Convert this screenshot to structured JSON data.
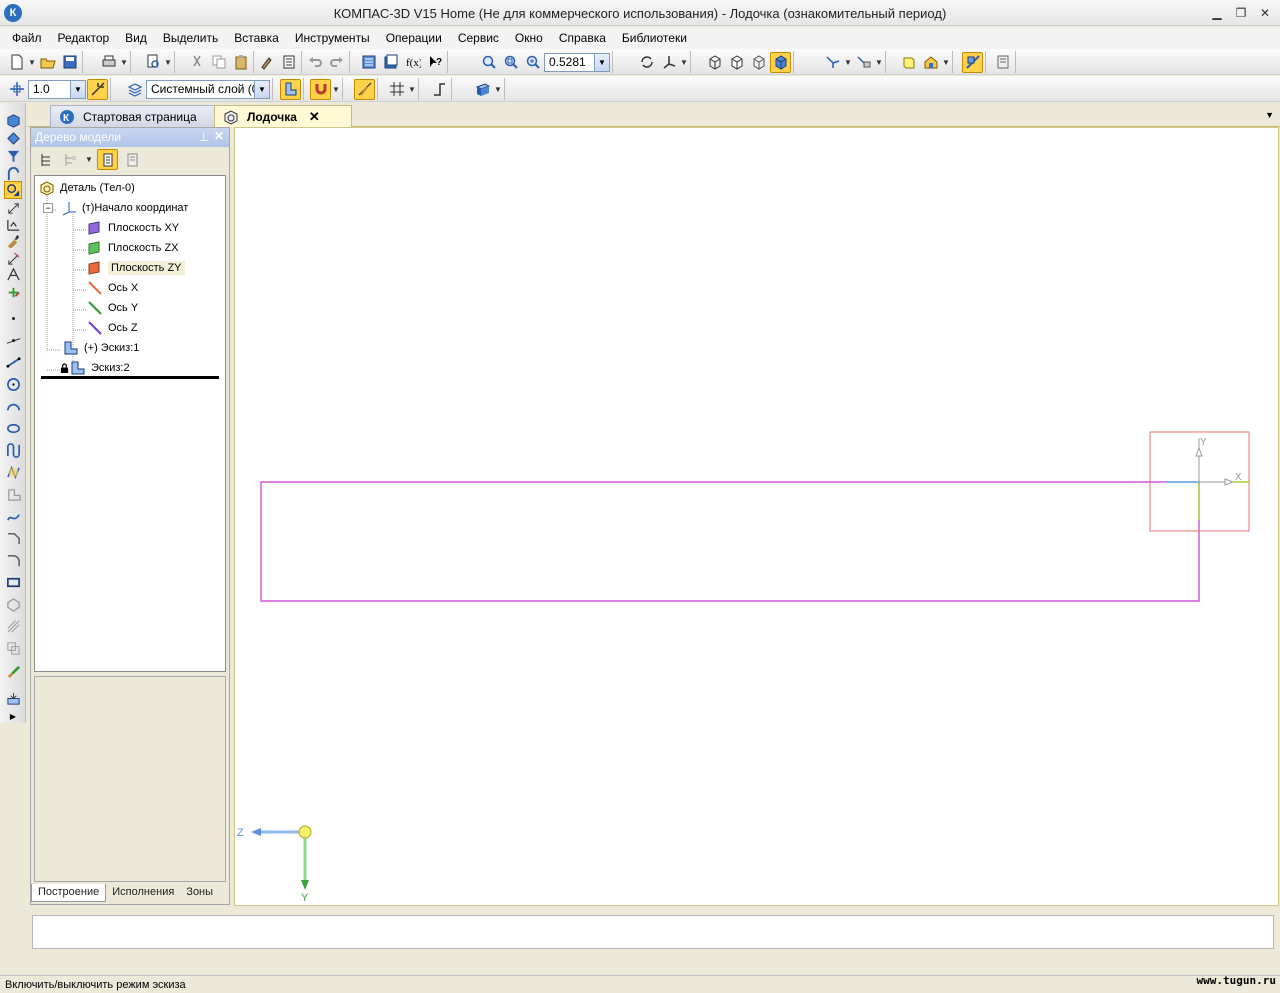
{
  "window": {
    "title": "КОМПАС-3D V15 Home (Не для коммерческого использования) - Лодочка (ознакомительный период)",
    "app_icon": "К"
  },
  "menu": [
    {
      "label": "Файл"
    },
    {
      "label": "Редактор"
    },
    {
      "label": "Вид"
    },
    {
      "label": "Выделить"
    },
    {
      "label": "Вставка"
    },
    {
      "label": "Инструменты"
    },
    {
      "label": "Операции"
    },
    {
      "label": "Сервис"
    },
    {
      "label": "Окно"
    },
    {
      "label": "Справка"
    },
    {
      "label": "Библиотеки"
    }
  ],
  "toolbar": {
    "zoom_value": "0.5281",
    "step_value": "1.0",
    "layer_value": "Системный слой (0)"
  },
  "tabs": {
    "start": "Стартовая страница",
    "doc": "Лодочка",
    "close": "✕"
  },
  "tree": {
    "title": "Дерево модели",
    "nodes": [
      {
        "label": "Деталь (Тел-0)"
      },
      {
        "label": "(т)Начало координат"
      },
      {
        "label": "Плоскость XY"
      },
      {
        "label": "Плоскость ZX"
      },
      {
        "label": "Плоскость ZY"
      },
      {
        "label": "Ось X"
      },
      {
        "label": "Ось Y"
      },
      {
        "label": "Ось Z"
      },
      {
        "label": "(+) Эскиз:1"
      },
      {
        "label": "Эскиз:2"
      }
    ],
    "bottom_tabs": [
      {
        "label": "Построение"
      },
      {
        "label": "Исполнения"
      },
      {
        "label": "Зоны"
      }
    ]
  },
  "canvas": {
    "axis_x": "X",
    "axis_y": "Y",
    "axis_z": "Z",
    "triad_y": "Y"
  },
  "status": {
    "text": "Включить/выключить режим эскиза",
    "watermark": "www.tugun.ru"
  },
  "colors": {
    "sketch_line": "#cc33cc",
    "selection_box": "#ee7070",
    "active_accent": "#ffd24a"
  }
}
